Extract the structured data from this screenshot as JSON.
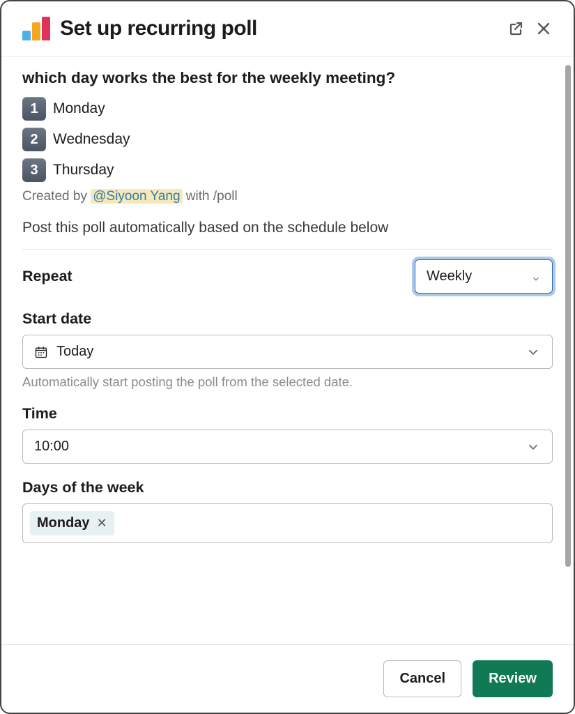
{
  "header": {
    "title": "Set up recurring poll"
  },
  "poll": {
    "question": "which day works the best for the weekly meeting?",
    "options": [
      {
        "num": "1",
        "label": "Monday"
      },
      {
        "num": "2",
        "label": "Wednesday"
      },
      {
        "num": "3",
        "label": "Thursday"
      }
    ],
    "created_prefix": "Created by ",
    "created_mention": "@Siyoon Yang",
    "created_suffix": " with /poll"
  },
  "schedule": {
    "description": "Post this poll automatically based on the schedule below",
    "repeat_label": "Repeat",
    "repeat_value": "Weekly",
    "start_date_label": "Start date",
    "start_date_value": "Today",
    "start_date_hint": "Automatically start posting the poll from the selected date.",
    "time_label": "Time",
    "time_value": "10:00",
    "days_label": "Days of the week",
    "days_selected": [
      "Monday"
    ]
  },
  "footer": {
    "cancel": "Cancel",
    "review": "Review"
  }
}
